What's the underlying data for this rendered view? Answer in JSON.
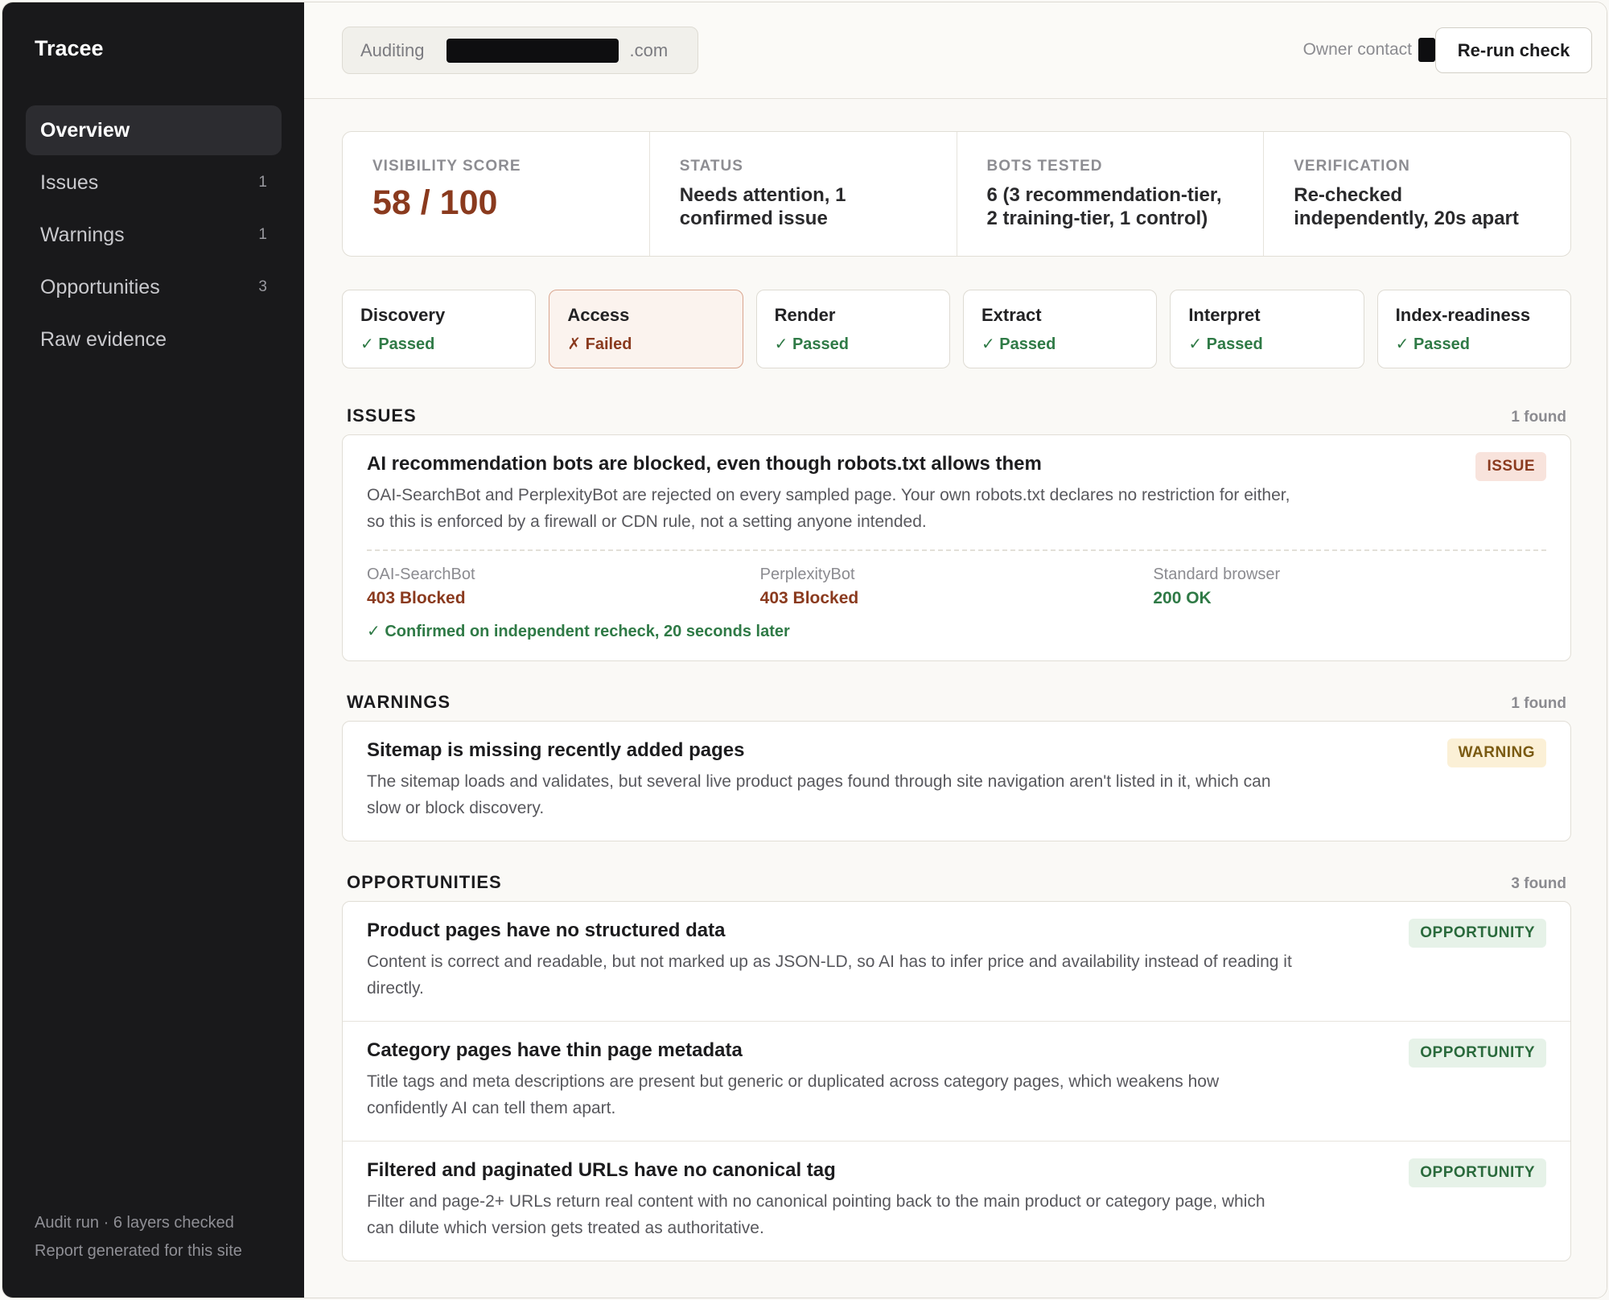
{
  "sidebar": {
    "brand": "Tracee",
    "items": [
      {
        "label": "Overview",
        "count": ""
      },
      {
        "label": "Issues",
        "count": "1"
      },
      {
        "label": "Warnings",
        "count": "1"
      },
      {
        "label": "Opportunities",
        "count": "3"
      },
      {
        "label": "Raw evidence",
        "count": ""
      }
    ],
    "footer_line1": "Audit run · 6 layers checked",
    "footer_line2": "Report generated for this site"
  },
  "topbar": {
    "auditing_label": "Auditing",
    "domain_suffix": ".com",
    "owner_contact": "Owner contact",
    "rerun_label": "Re-run check"
  },
  "stats": {
    "score_label": "VISIBILITY SCORE",
    "score_value": "58 / 100",
    "status_label": "STATUS",
    "status_value": "Needs attention, 1 confirmed issue",
    "bots_label": "BOTS TESTED",
    "bots_value": "6 (3 recommendation-tier, 2 training-tier, 1 control)",
    "verification_label": "VERIFICATION",
    "verification_value": "Re-checked independently, 20s apart"
  },
  "layers": [
    {
      "name": "Discovery",
      "status": "✓ Passed"
    },
    {
      "name": "Access",
      "status": "✗ Failed"
    },
    {
      "name": "Render",
      "status": "✓ Passed"
    },
    {
      "name": "Extract",
      "status": "✓ Passed"
    },
    {
      "name": "Interpret",
      "status": "✓ Passed"
    },
    {
      "name": "Index-readiness",
      "status": "✓ Passed"
    }
  ],
  "issues": {
    "title": "ISSUES",
    "count": "1 found",
    "items": [
      {
        "title": "AI recommendation bots are blocked, even though robots.txt allows them",
        "body": "OAI-SearchBot and PerplexityBot are rejected on every sampled page. Your own robots.txt declares no restriction for either, so this is enforced by a firewall or CDN rule, not a setting anyone intended.",
        "badge": "ISSUE",
        "evidence": [
          {
            "label": "OAI-SearchBot",
            "value": "403 Blocked"
          },
          {
            "label": "PerplexityBot",
            "value": "403 Blocked"
          },
          {
            "label": "Standard browser",
            "value": "200 OK"
          }
        ],
        "confirmation": "✓ Confirmed on independent recheck, 20 seconds later"
      }
    ]
  },
  "warnings": {
    "title": "WARNINGS",
    "count": "1 found",
    "items": [
      {
        "title": "Sitemap is missing recently added pages",
        "body": "The sitemap loads and validates, but several live product pages found through site navigation aren't listed in it, which can slow or block discovery.",
        "badge": "WARNING"
      }
    ]
  },
  "opportunities": {
    "title": "OPPORTUNITIES",
    "count": "3 found",
    "items": [
      {
        "title": "Product pages have no structured data",
        "body": "Content is correct and readable, but not marked up as JSON-LD, so AI has to infer price and availability instead of reading it directly.",
        "badge": "OPPORTUNITY"
      },
      {
        "title": "Category pages have thin page metadata",
        "body": "Title tags and meta descriptions are present but generic or duplicated across category pages, which weakens how confidently AI can tell them apart.",
        "badge": "OPPORTUNITY"
      },
      {
        "title": "Filtered and paginated URLs have no canonical tag",
        "body": "Filter and page-2+ URLs return real content with no canonical pointing back to the main product or category page, which can dilute which version gets treated as authoritative.",
        "badge": "OPPORTUNITY"
      }
    ]
  }
}
